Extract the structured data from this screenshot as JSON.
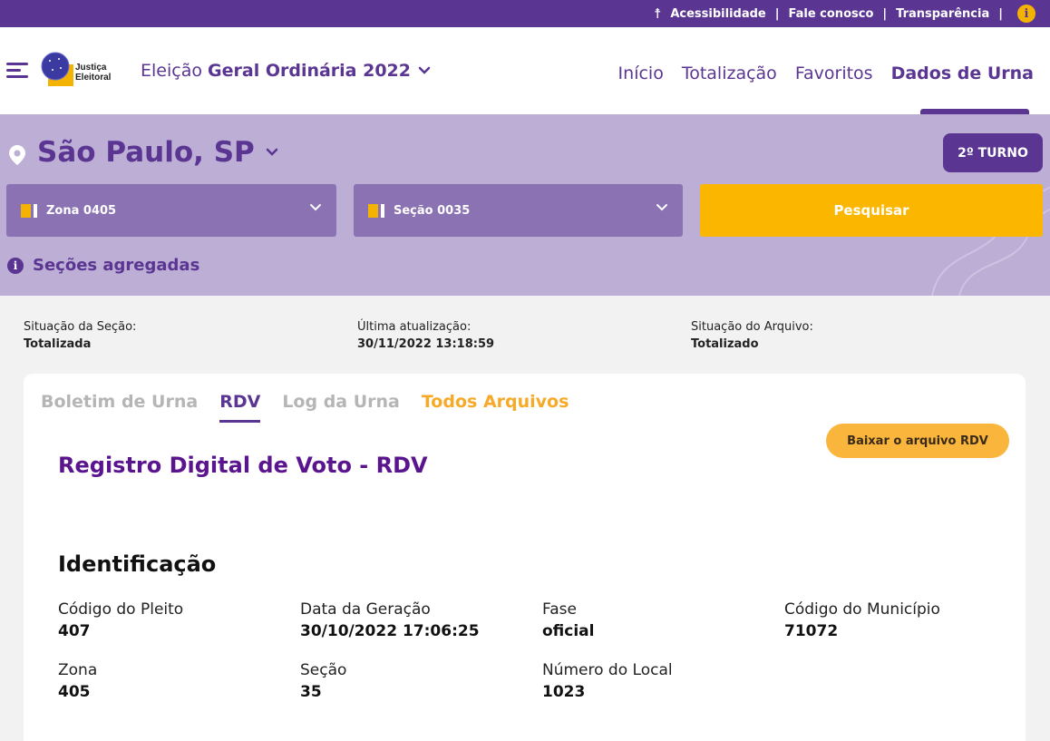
{
  "topbar": {
    "accessibility": "Acessibilidade",
    "contact": "Fale conosco",
    "transparency": "Transparência",
    "separator": "|",
    "info_glyph": "i"
  },
  "header": {
    "logo_line1": "Justiça",
    "logo_line2": "Eleitoral",
    "election_prefix": "Eleição",
    "election_name": "Geral Ordinária 2022",
    "nav": [
      "Início",
      "Totalização",
      "Favoritos",
      "Dados de Urna"
    ]
  },
  "location": {
    "city": "São Paulo, SP",
    "turn": "2º TURNO",
    "zone": "Zona 0405",
    "section": "Seção 0035",
    "search": "Pesquisar",
    "aggregated": "Seções agregadas"
  },
  "status": {
    "section_label": "Situação da Seção:",
    "section_value": "Totalizada",
    "updated_label": "Última atualização:",
    "updated_value": "30/11/2022 13:18:59",
    "file_label": "Situação do Arquivo:",
    "file_value": "Totalizado"
  },
  "card": {
    "tabs": [
      "Boletim de Urna",
      "RDV",
      "Log da Urna",
      "Todos Arquivos"
    ],
    "download": "Baixar o arquivo RDV",
    "title": "Registro Digital de Voto - RDV",
    "id_title": "Identificação",
    "fields": [
      {
        "label": "Código do Pleito",
        "value": "407"
      },
      {
        "label": "Data da Geração",
        "value": "30/10/2022 17:06:25"
      },
      {
        "label": "Fase",
        "value": "oficial"
      },
      {
        "label": "Código do Município",
        "value": "71072"
      },
      {
        "label": "Zona",
        "value": "405"
      },
      {
        "label": "Seção",
        "value": "35"
      },
      {
        "label": "Número do Local",
        "value": "1023"
      }
    ]
  },
  "colors": {
    "brand_purple": "#5a3592",
    "accent_yellow": "#fbb700",
    "panel_lavender": "#bcaed5"
  }
}
